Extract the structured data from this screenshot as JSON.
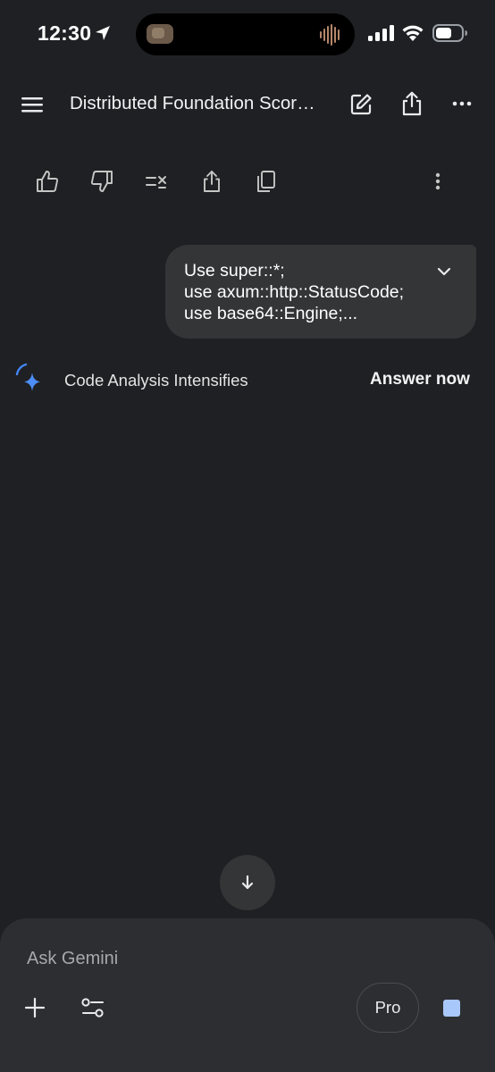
{
  "status_bar": {
    "time": "12:30"
  },
  "app_bar": {
    "title": "Distributed Foundation Scor…"
  },
  "prompt": {
    "lines": [
      "Use super::*;",
      "use axum::http::StatusCode;",
      "use base64::Engine;..."
    ]
  },
  "thinking": {
    "label": "Code Analysis Intensifies",
    "answer_now_label": "Answer now"
  },
  "composer": {
    "placeholder": "Ask Gemini",
    "model_label": "Pro"
  },
  "colors": {
    "background": "#1f2023",
    "bubble": "#333537",
    "composer": "#2d2e31",
    "accent_blue": "#a8c7fa",
    "gemini_blue": "#4285f4"
  },
  "icons": {
    "top_bar": [
      "menu-icon",
      "edit-icon",
      "share-icon",
      "more-horizontal-icon"
    ],
    "actions": [
      "thumbs-up-icon",
      "thumbs-down-icon",
      "modify-response-icon",
      "share-icon",
      "copy-icon",
      "more-vertical-icon"
    ],
    "composer": [
      "plus-icon",
      "tools-icon",
      "stop-icon"
    ]
  }
}
